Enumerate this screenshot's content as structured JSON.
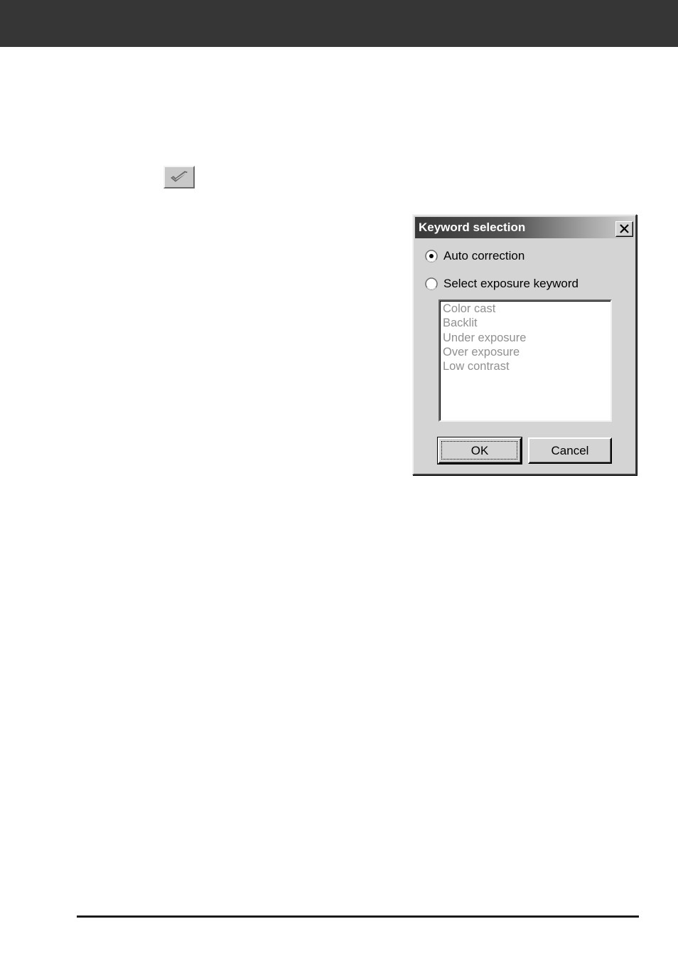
{
  "toolbar": {
    "icon": "checkmark-icon"
  },
  "dialog": {
    "title": "Keyword selection",
    "close_icon": "close-icon",
    "options": [
      {
        "label": "Auto correction",
        "selected": true
      },
      {
        "label": "Select exposure keyword",
        "selected": false
      }
    ],
    "keywords": [
      "Color cast",
      "Backlit",
      "Under exposure",
      "Over exposure",
      "Low contrast"
    ],
    "buttons": {
      "ok": "OK",
      "cancel": "Cancel"
    }
  }
}
